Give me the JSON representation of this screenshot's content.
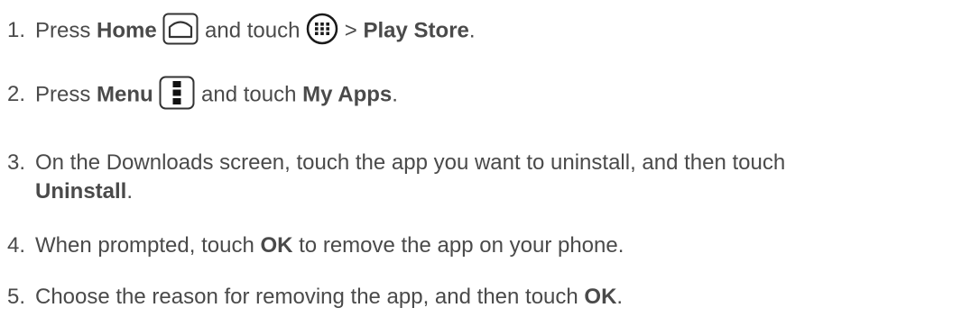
{
  "steps": [
    {
      "number": "1.",
      "pre": "Press ",
      "home_label": "Home",
      "mid": " and touch ",
      "sep": " > ",
      "store_label": "Play Store",
      "end": "."
    },
    {
      "number": "2.",
      "pre": "Press ",
      "menu_label": "Menu",
      "mid": " and touch ",
      "apps_label": "My Apps",
      "end": "."
    },
    {
      "number": "3.",
      "line1": "On the Downloads screen, touch the app you want to uninstall, and then touch",
      "uninstall_label": "Uninstall",
      "end": "."
    },
    {
      "number": "4.",
      "pre": "When prompted, touch ",
      "ok_label": "OK",
      "post": " to remove the app on your phone."
    },
    {
      "number": "5.",
      "pre": "Choose the reason for removing the app, and then touch ",
      "ok_label": "OK",
      "end": "."
    }
  ],
  "icons": {
    "home": "home-key-icon",
    "apps": "apps-launcher-icon",
    "menu": "menu-key-icon"
  }
}
